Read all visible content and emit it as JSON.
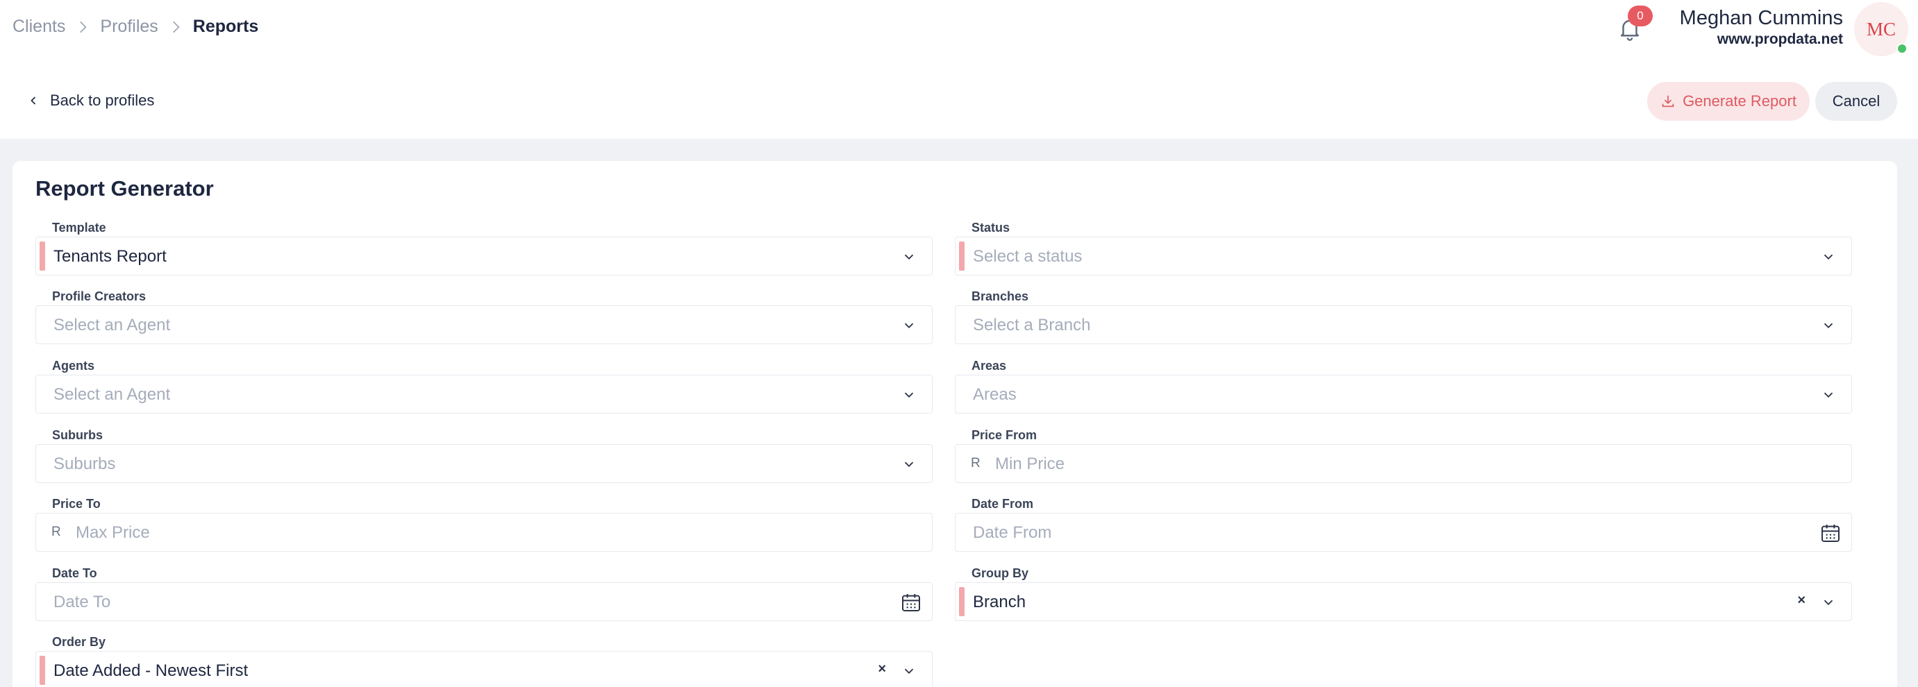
{
  "breadcrumb": {
    "items": [
      {
        "label": "Clients"
      },
      {
        "label": "Profiles"
      },
      {
        "label": "Reports"
      }
    ]
  },
  "notifications": {
    "count": "0",
    "icon": "bell-icon"
  },
  "user": {
    "name": "Meghan Cummins",
    "site": "www.propdata.net",
    "initials": "MC",
    "status_color": "#4cc268"
  },
  "actions": {
    "back_label": "Back to profiles",
    "generate_label": "Generate Report",
    "cancel_label": "Cancel"
  },
  "form": {
    "title": "Report Generator",
    "fields": {
      "template": {
        "label": "Template",
        "value": "Tenants Report"
      },
      "status": {
        "label": "Status",
        "placeholder": "Select a status"
      },
      "profile_creators": {
        "label": "Profile Creators",
        "placeholder": "Select an Agent"
      },
      "branches": {
        "label": "Branches",
        "placeholder": "Select a Branch"
      },
      "agents": {
        "label": "Agents",
        "placeholder": "Select an Agent"
      },
      "areas": {
        "label": "Areas",
        "placeholder": "Areas"
      },
      "suburbs": {
        "label": "Suburbs",
        "placeholder": "Suburbs"
      },
      "price_from": {
        "label": "Price From",
        "prefix": "R",
        "placeholder": "Min Price"
      },
      "price_to": {
        "label": "Price To",
        "prefix": "R",
        "placeholder": "Max Price"
      },
      "date_from": {
        "label": "Date From",
        "placeholder": "Date From"
      },
      "date_to": {
        "label": "Date To",
        "placeholder": "Date To"
      },
      "group_by": {
        "label": "Group By",
        "value": "Branch",
        "clear": "×"
      },
      "order_by": {
        "label": "Order By",
        "value": "Date Added - Newest First",
        "clear": "×"
      }
    }
  },
  "colors": {
    "accent": "#e85a61",
    "required_marker": "#f4a8ab",
    "generate_bg": "#fbe6e7"
  }
}
